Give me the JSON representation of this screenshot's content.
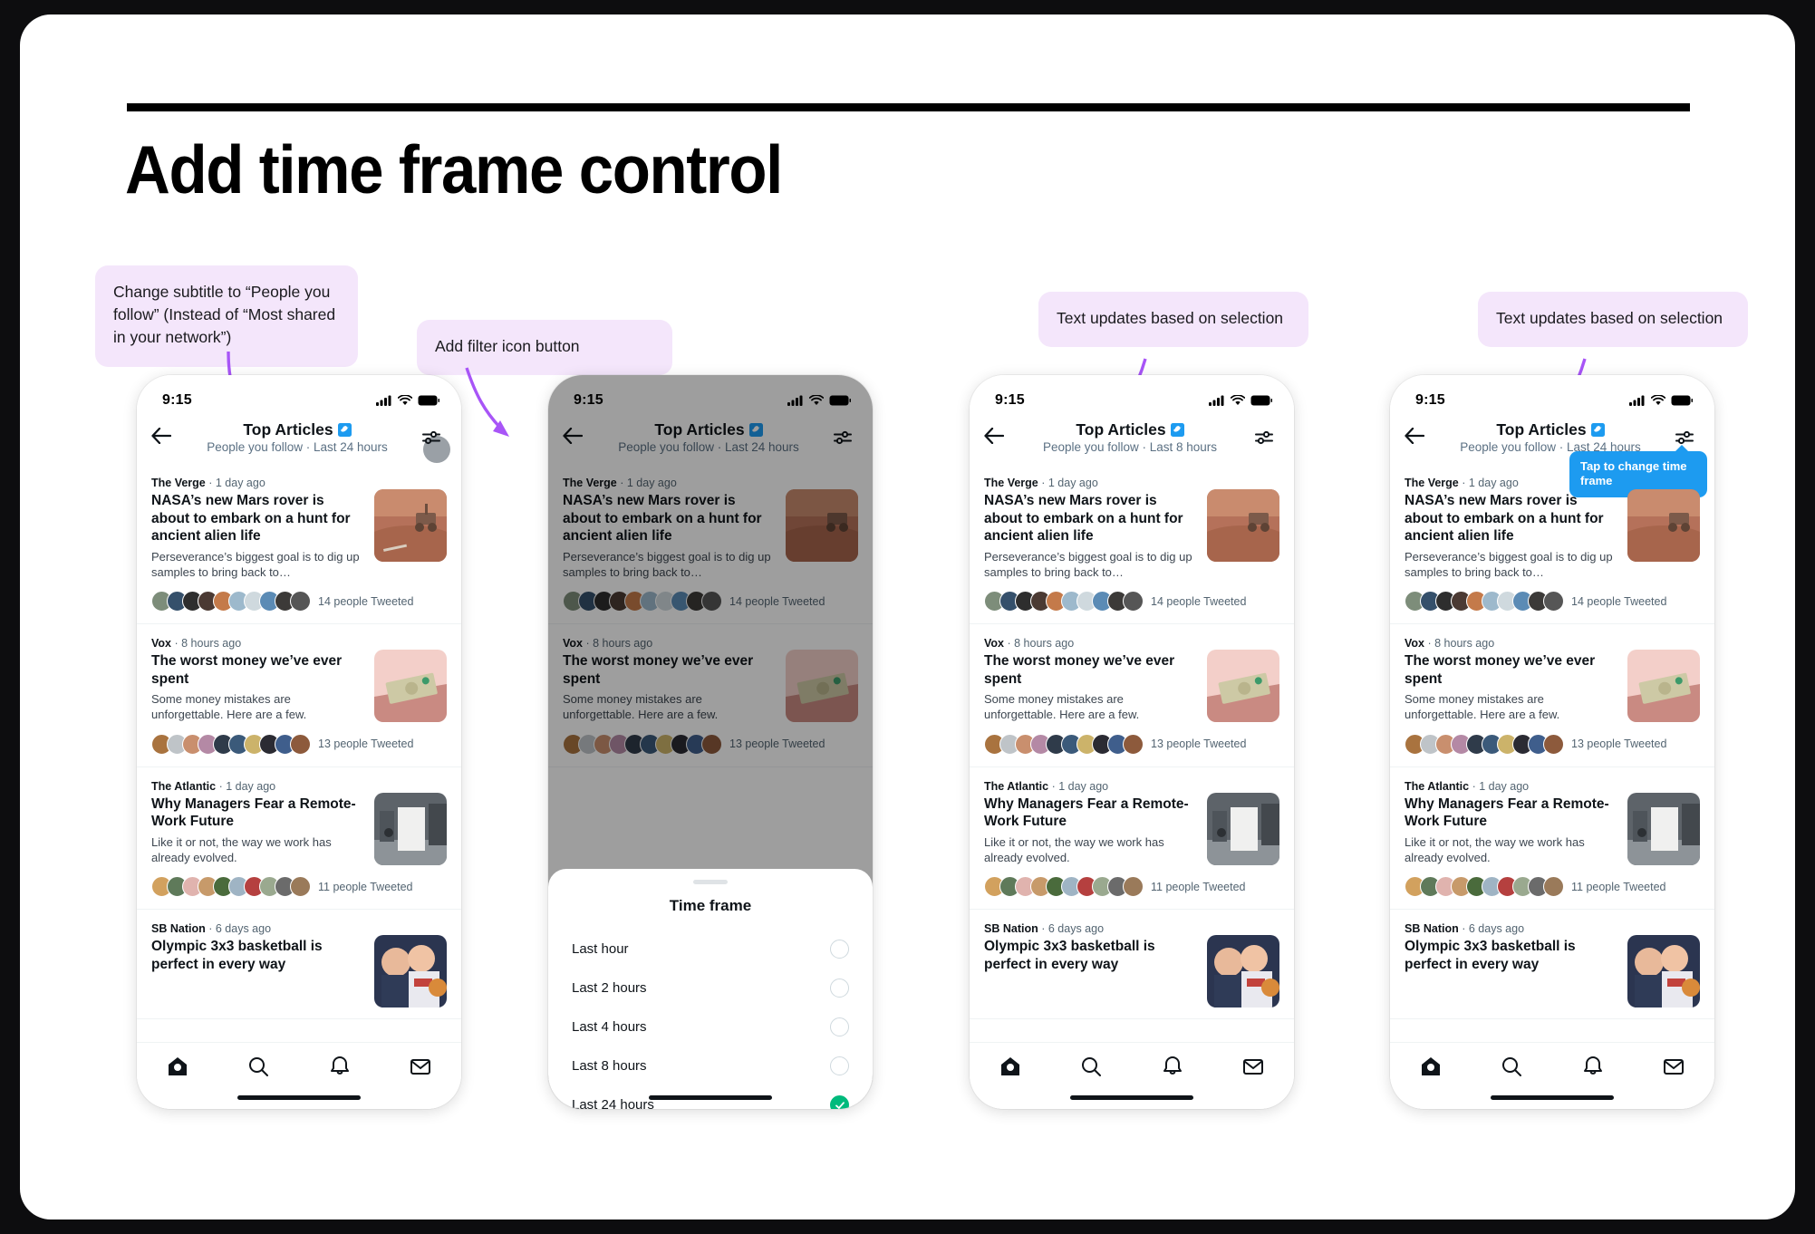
{
  "page": {
    "title": "Add time frame control"
  },
  "callouts": [
    {
      "id": "subtitle",
      "text": "Change subtitle to “People you follow” (Instead of “Most shared in your network”)"
    },
    {
      "id": "filter",
      "text": "Add filter icon button"
    },
    {
      "id": "updates-3",
      "text": "Text updates based on selection"
    },
    {
      "id": "updates-4",
      "text": "Text updates based on selection"
    }
  ],
  "status_bar": {
    "time": "9:15"
  },
  "nav": {
    "title": "Top Articles",
    "subtitle_24": "People you follow · Last 24 hours",
    "subtitle_8": "People you follow · Last 8 hours"
  },
  "articles": [
    {
      "source": "The Verge",
      "age": "1 day ago",
      "title": "NASA’s new Mars rover is about to embark on a hunt for ancient alien life",
      "desc": "Perseverance’s biggest goal is to dig up samples to bring back to…",
      "tweets": "14 people Tweeted"
    },
    {
      "source": "Vox",
      "age": "8 hours ago",
      "title": "The worst money we’ve ever spent",
      "desc": "Some money mistakes are unforgettable. Here are a few.",
      "tweets": "13 people Tweeted"
    },
    {
      "source": "The Atlantic",
      "age": "1 day ago",
      "title": "Why Managers Fear a Remote-Work Future",
      "desc": "Like it or not, the way we work has already evolved.",
      "tweets": "11 people Tweeted"
    },
    {
      "source": "SB Nation",
      "age": "6 days ago",
      "title": "Olympic 3x3 basketball is perfect in every way",
      "desc": "",
      "tweets": ""
    }
  ],
  "sheet": {
    "title": "Time frame",
    "options": [
      {
        "label": "Last hour",
        "selected": false
      },
      {
        "label": "Last 2 hours",
        "selected": false
      },
      {
        "label": "Last 4 hours",
        "selected": false
      },
      {
        "label": "Last 8 hours",
        "selected": false
      },
      {
        "label": "Last 24 hours",
        "selected": true
      }
    ]
  },
  "tooltip": {
    "text": "Tap to change time frame"
  },
  "tabs": [
    {
      "name": "home",
      "label": "Home"
    },
    {
      "name": "search",
      "label": "Search"
    },
    {
      "name": "notifications",
      "label": "Notifications"
    },
    {
      "name": "messages",
      "label": "Messages"
    }
  ],
  "colors": {
    "callout_bg": "#f4e6fb",
    "annotation_line": "#a855f7",
    "verified_blue": "#1d9bf0",
    "selected_green": "#00ba7c",
    "tooltip_blue": "#1d9bf0"
  }
}
